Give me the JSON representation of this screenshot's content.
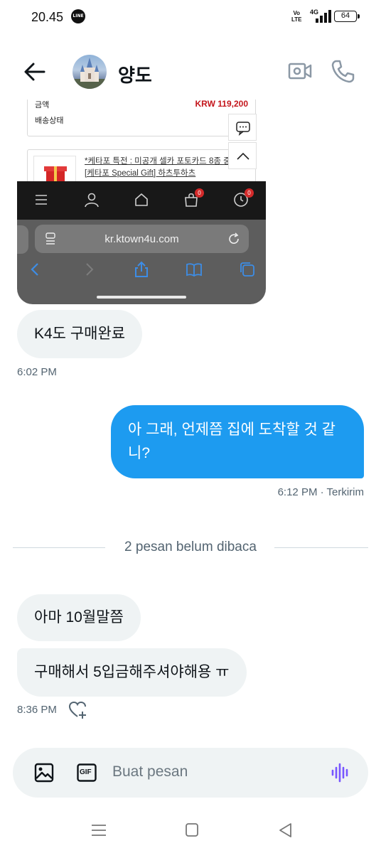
{
  "status_bar": {
    "time": "20.45",
    "app_badge": "LINE",
    "volte_line1": "Vo",
    "volte_line2": "LTE",
    "network": "4G",
    "battery": "64"
  },
  "header": {
    "contact_name": "양도",
    "avatar_icon": "castle-avatar",
    "back_icon": "arrow-left-icon",
    "video_icon": "video-call-icon",
    "call_icon": "phone-icon"
  },
  "shared_image": {
    "amount_label": "금액",
    "amount_value": "KRW 119,200",
    "shipping_label": "배송상태",
    "product_text": "*케타포 특전 : 미공개 셀카 포토카드 8종 중 랜덤* [케타포 Special Gift] 하츠투하츠",
    "url": "kr.ktown4u.com",
    "cart_badge": "0",
    "recent_badge": "0"
  },
  "messages": [
    {
      "direction": "in",
      "text": "K4도 구매완료"
    },
    {
      "direction": "out",
      "text_line1": "아 그래, 언제쯤 집에 도착할 것 같",
      "text_line2": "니?"
    },
    {
      "direction": "in",
      "text": "아마 10월말쯤"
    },
    {
      "direction": "in",
      "text": "구매해서 5입금해주셔야해용 ㅠ"
    }
  ],
  "timestamps": {
    "first_in": "6:02 PM",
    "out": "6:12 PM · Terkirim",
    "last_in": "8:36 PM"
  },
  "unread_divider": "2 pesan belum dibaca",
  "composer": {
    "placeholder": "Buat pesan",
    "gif_label": "GIF"
  },
  "colors": {
    "accent": "#1d9bf0",
    "incoming_bubble": "#eff3f4",
    "voice": "#7856ff",
    "price_red": "#c4161c"
  }
}
